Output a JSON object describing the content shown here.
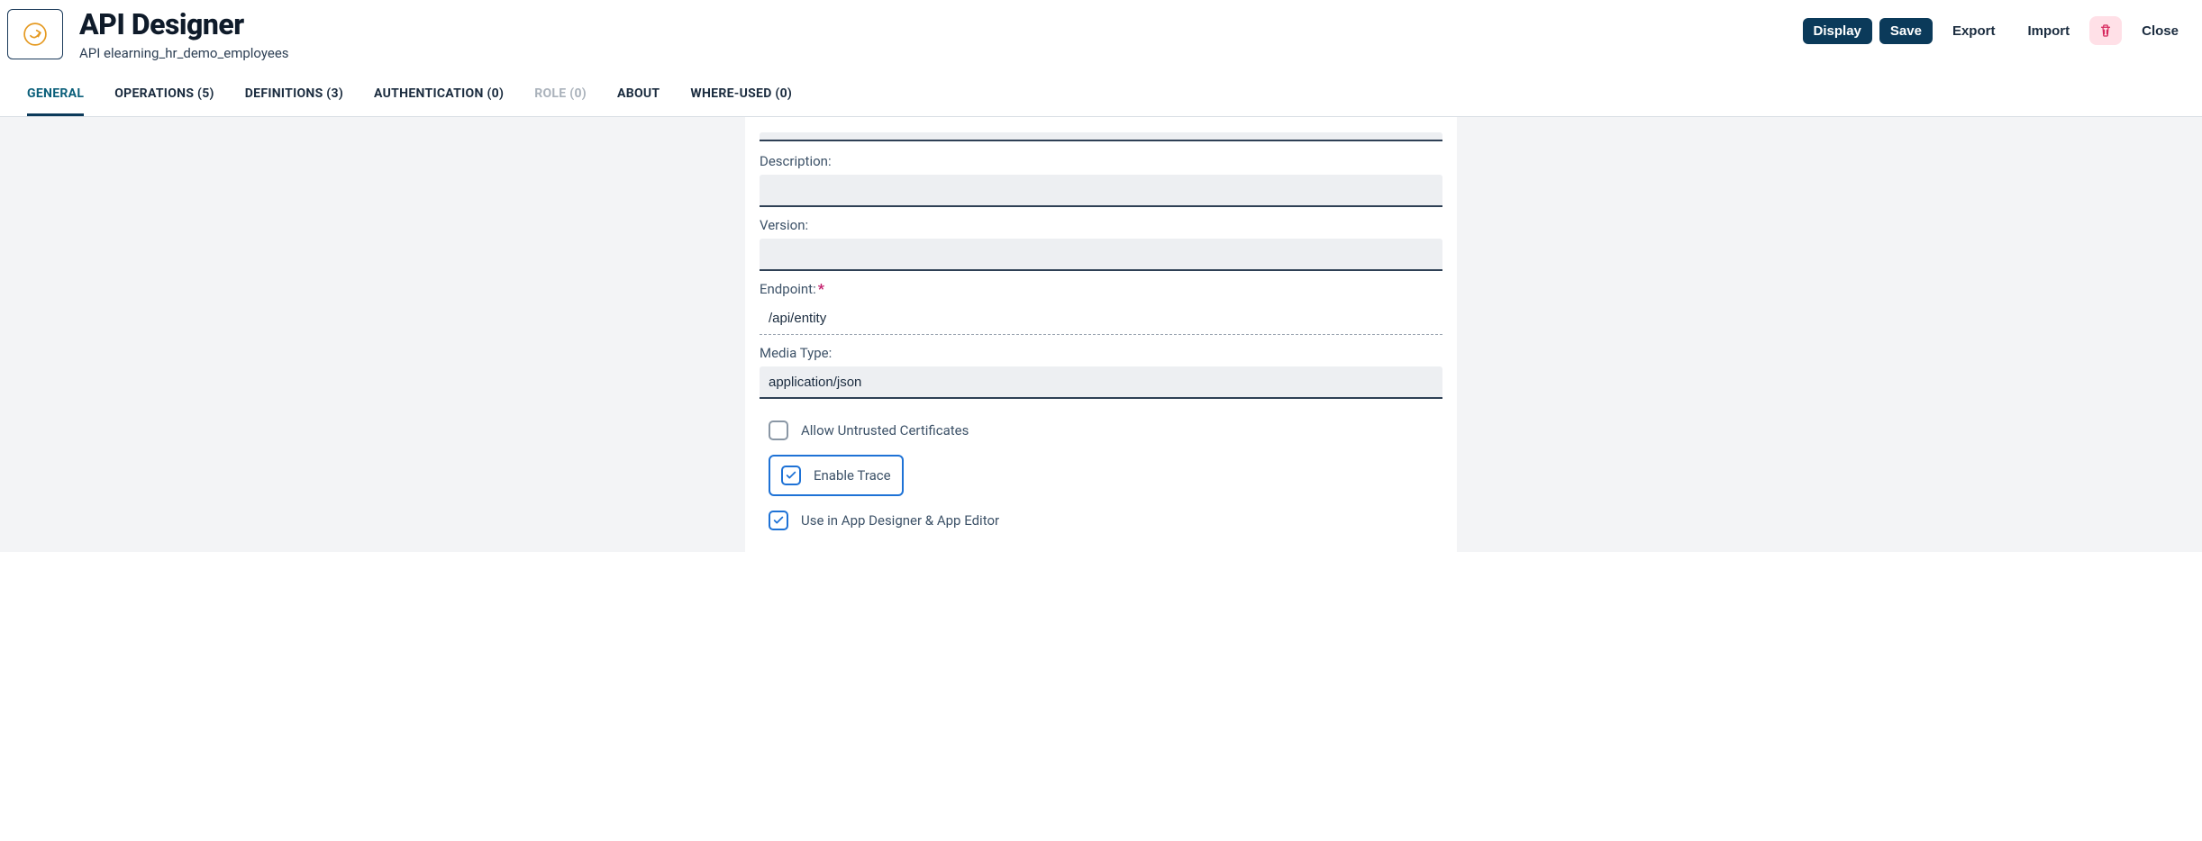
{
  "header": {
    "title": "API Designer",
    "subtitle": "API elearning_hr_demo_employees",
    "actions": {
      "display": "Display",
      "save": "Save",
      "export": "Export",
      "import": "Import",
      "close": "Close"
    }
  },
  "tabs": [
    {
      "label": "GENERAL",
      "state": "active"
    },
    {
      "label": "OPERATIONS (5)",
      "state": "normal"
    },
    {
      "label": "DEFINITIONS (3)",
      "state": "normal"
    },
    {
      "label": "AUTHENTICATION (0)",
      "state": "normal"
    },
    {
      "label": "ROLE (0)",
      "state": "disabled"
    },
    {
      "label": "ABOUT",
      "state": "normal"
    },
    {
      "label": "WHERE-USED (0)",
      "state": "normal"
    }
  ],
  "form": {
    "description": {
      "label": "Description:",
      "value": ""
    },
    "version": {
      "label": "Version:",
      "value": ""
    },
    "endpoint": {
      "label": "Endpoint:",
      "required": true,
      "value": "/api/entity"
    },
    "mediaType": {
      "label": "Media Type:",
      "value": "application/json"
    },
    "checkboxes": {
      "allowUntrusted": {
        "label": "Allow Untrusted Certificates",
        "checked": false
      },
      "enableTrace": {
        "label": "Enable Trace",
        "checked": true,
        "highlighted": true
      },
      "useInDesigner": {
        "label": "Use in App Designer & App Editor",
        "checked": true
      }
    }
  }
}
